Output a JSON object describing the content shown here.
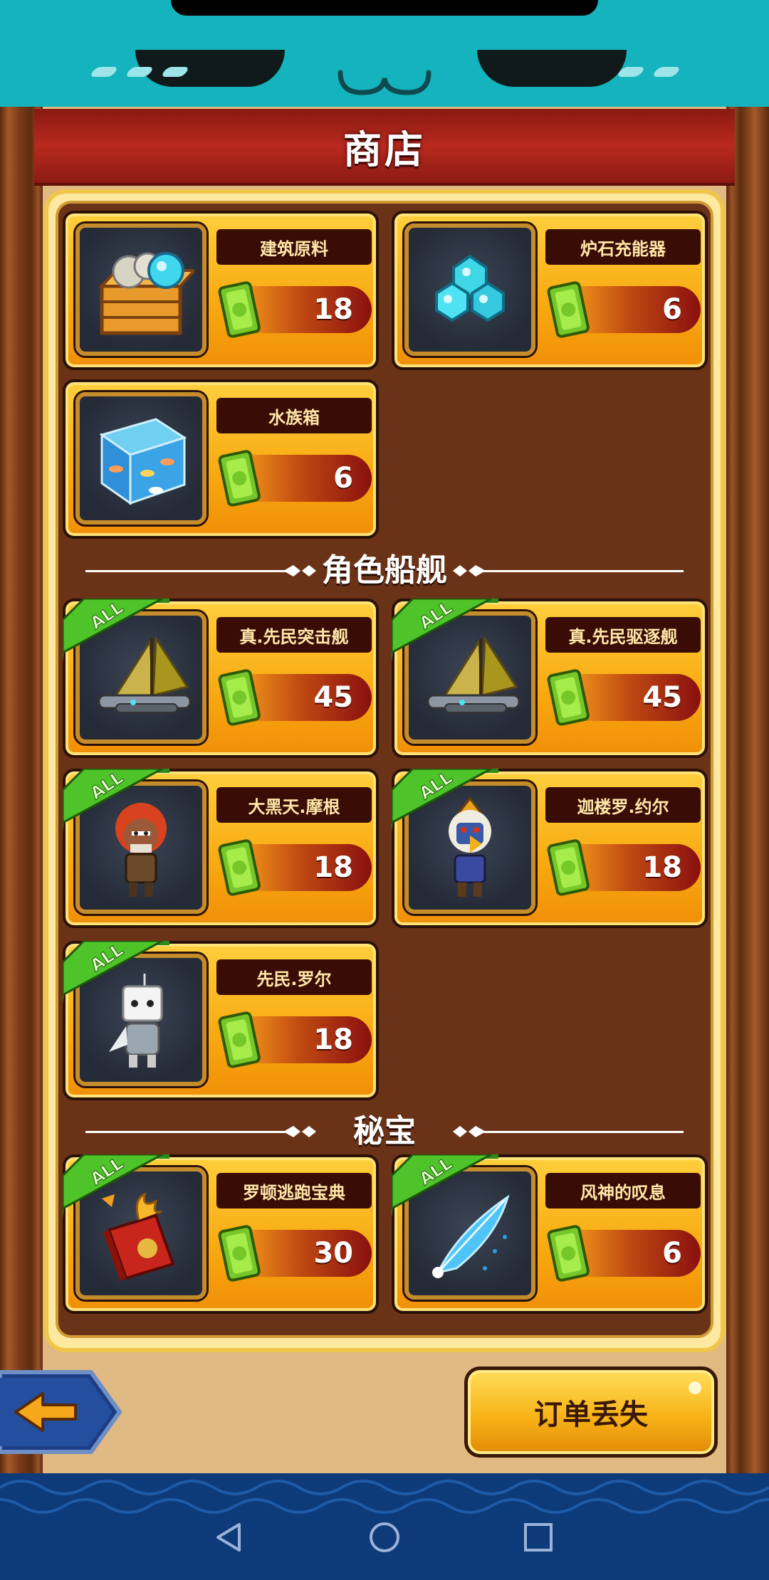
{
  "header": {
    "title": "商店"
  },
  "sections": {
    "characters": "角色船舰",
    "treasures": "秘宝"
  },
  "items": [
    {
      "name": "建筑原料",
      "price": 18,
      "icon": "building-materials-crate-icon",
      "all": false
    },
    {
      "name": "炉石充能器",
      "price": 6,
      "icon": "blue-crystals-icon",
      "all": false
    },
    {
      "name": "水族箱",
      "price": 6,
      "icon": "fish-tank-icon",
      "all": false
    },
    {
      "name": "真.先民突击舰",
      "price": 45,
      "icon": "sail-ship-icon",
      "all": true
    },
    {
      "name": "真.先民驱逐舰",
      "price": 45,
      "icon": "sail-ship-icon",
      "all": true
    },
    {
      "name": "大黑天.摩根",
      "price": 18,
      "icon": "red-haired-warrior-icon",
      "all": true
    },
    {
      "name": "迦楼罗.约尔",
      "price": 18,
      "icon": "bird-masked-warrior-icon",
      "all": true
    },
    {
      "name": "先民.罗尔",
      "price": 18,
      "icon": "white-robot-icon",
      "all": true
    },
    {
      "name": "罗顿逃跑宝典",
      "price": 30,
      "icon": "red-book-icon",
      "all": true
    },
    {
      "name": "风神的叹息",
      "price": 6,
      "icon": "blue-feather-icon",
      "all": true
    }
  ],
  "badge_text": "ALL",
  "buttons": {
    "order_lost": "订单丢失"
  },
  "colors": {
    "accent": "#f8a910",
    "title_banner": "#b8291e",
    "header_teal": "#14b3bd"
  }
}
